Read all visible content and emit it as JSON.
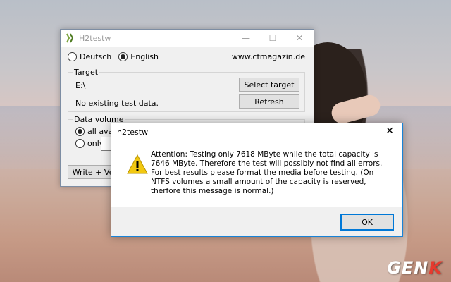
{
  "main_window": {
    "title": "H2testw",
    "languages": [
      {
        "label": "Deutsch",
        "selected": false
      },
      {
        "label": "English",
        "selected": true
      }
    ],
    "url": "www.ctmagazin.de",
    "target_group": {
      "legend": "Target",
      "path": "E:\\",
      "status": "No existing test data.",
      "select_button": "Select target",
      "refresh_button": "Refresh"
    },
    "data_volume_group": {
      "legend": "Data volume",
      "option_all": "all availab",
      "option_only": "only"
    },
    "write_button": "Write + Ve"
  },
  "dialog": {
    "title": "h2testw",
    "message": "Attention: Testing only 7618 MByte while the total capacity is 7646 MByte. Therefore the test will possibly not find all errors. For best results please format the media before testing. (On NTFS volumes a small amount of the capacity is reserved, therfore this message is normal.)",
    "ok_button": "OK",
    "close_glyph": "✕"
  },
  "watermark": {
    "prefix": "GEN",
    "suffix": "K"
  },
  "colors": {
    "accent": "#0078d7",
    "warning": "#f2c811"
  }
}
